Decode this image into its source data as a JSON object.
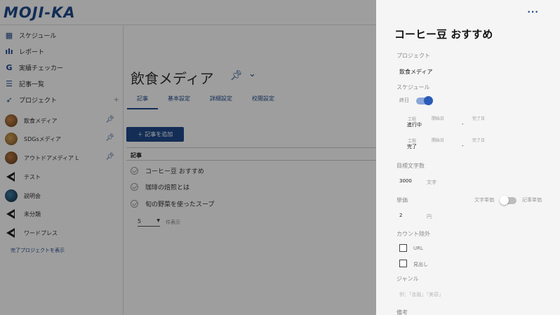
{
  "app": {
    "logo": "MOJI-KA"
  },
  "sidebar": {
    "nav": [
      {
        "label": "スケジュール",
        "icon": "calendar-icon"
      },
      {
        "label": "レポート",
        "icon": "bar-chart-icon"
      },
      {
        "label": "実績チェッカー",
        "icon": "google-g-icon"
      },
      {
        "label": "記事一覧",
        "icon": "list-icon"
      },
      {
        "label": "プロジェクト",
        "icon": "rocket-icon",
        "add": "+"
      }
    ],
    "projects": [
      {
        "label": "飲食メディア",
        "avatar": "food",
        "pinned": true
      },
      {
        "label": "SDGsメディア",
        "avatar": "sdg",
        "pinned": true
      },
      {
        "label": "アウトドアメディア L",
        "avatar": "out",
        "pinned": true
      },
      {
        "label": "テスト",
        "avatar": "logo",
        "pinned": false
      },
      {
        "label": "説明会",
        "avatar": "brief",
        "pinned": false
      },
      {
        "label": "未分類",
        "avatar": "logo",
        "pinned": false
      },
      {
        "label": "ワードプレス",
        "avatar": "logo",
        "pinned": false
      }
    ],
    "show_done": "完了プロジェクトを表示"
  },
  "main": {
    "title": "飲食メディア",
    "tabs": [
      "記事",
      "基本設定",
      "詳細設定",
      "校閲設定"
    ],
    "add_button": "＋ 記事を追加",
    "list_header": "記事",
    "articles": [
      "コーヒー豆 おすすめ",
      "珈琲の焙煎とは",
      "旬の野菜を使ったスープ"
    ],
    "pager": {
      "value": "5",
      "unit": "件表示"
    }
  },
  "drawer": {
    "more": "···",
    "title": "コーヒー豆 おすすめ",
    "project_label": "プロジェクト",
    "project_value": "飲食メディア",
    "schedule_label": "スケジュール",
    "all_day_label": "終日",
    "all_day_on": true,
    "steps": [
      {
        "caption": "工程",
        "value": "進行中",
        "start_caption": "開始日",
        "end_caption": "完了日",
        "dash": "-"
      },
      {
        "caption": "工程",
        "value": "完了",
        "start_caption": "開始日",
        "end_caption": "完了日",
        "dash": "-"
      }
    ],
    "target_label": "目標文字数",
    "target_value": "3000",
    "target_unit": "文字",
    "price_label": "単価",
    "price_mode_left": "文字単価",
    "price_mode_right": "記事単価",
    "price_value": "2",
    "price_unit": "円",
    "exclude_label": "カウント除外",
    "exclude_options": [
      "URL",
      "見出し"
    ],
    "genre_label": "ジャンル",
    "genre_placeholder": "例：「金融」「美容」",
    "notes_label": "備考"
  },
  "colors": {
    "brand": "#1f4a8c",
    "toggle_on": "#2a5bb7"
  }
}
